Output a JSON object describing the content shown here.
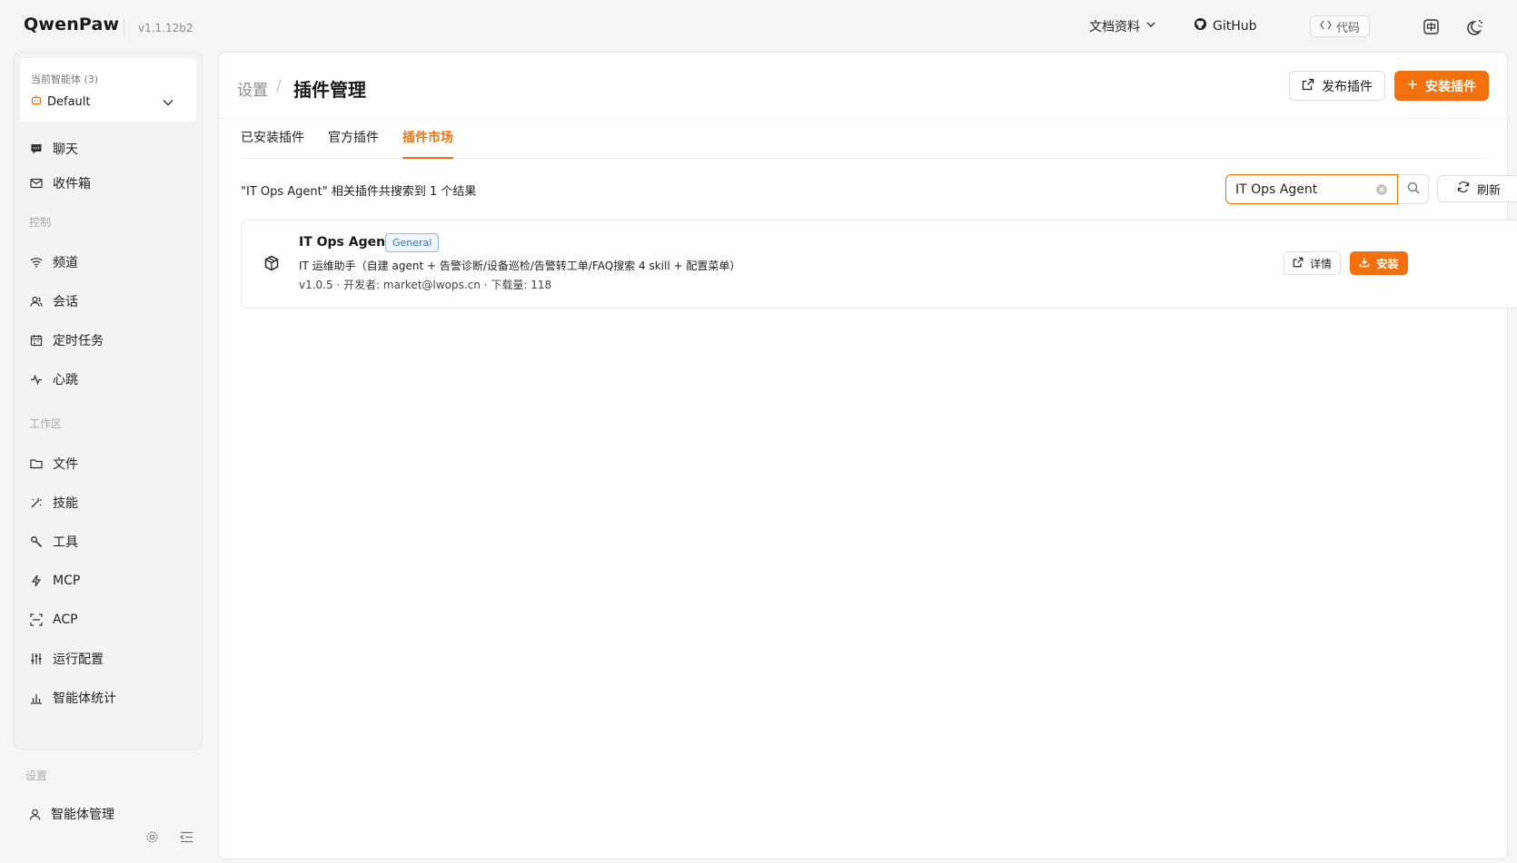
{
  "app": {
    "logo": "QwenPaw",
    "version": "v1.1.12b2"
  },
  "topnav": {
    "docs_label": "文档资料",
    "github_label": "GitHub",
    "code_label": "代码"
  },
  "sidebar": {
    "agent_label": "当前智能体 (3)",
    "agent_value": "Default",
    "items": [
      {
        "label": "聊天"
      },
      {
        "label": "收件箱"
      },
      {
        "label": "频道"
      },
      {
        "label": "会话"
      },
      {
        "label": "定时任务"
      },
      {
        "label": "心跳"
      },
      {
        "label": "文件"
      },
      {
        "label": "技能"
      },
      {
        "label": "工具"
      },
      {
        "label": "MCP"
      },
      {
        "label": "ACP"
      },
      {
        "label": "运行配置"
      },
      {
        "label": "智能体统计"
      }
    ],
    "sections": {
      "control": "控制",
      "workspace": "工作区",
      "settings": "设置"
    },
    "agent_manage": "智能体管理"
  },
  "page": {
    "breadcrumb_parent": "设置",
    "breadcrumb_separator": "/",
    "title": "插件管理",
    "publish_label": "发布插件",
    "install_plugin_label": "安装插件",
    "tabs": [
      {
        "label": "已安装插件"
      },
      {
        "label": "官方插件"
      },
      {
        "label": "插件市场"
      }
    ],
    "result_text": "\"IT Ops Agent\" 相关插件共搜索到 1 个结果",
    "search": {
      "value": "IT Ops Agent"
    },
    "refresh_label": "刷新"
  },
  "plugin": {
    "name": "IT Ops Agent",
    "tag": "General",
    "description": "IT 运维助手（自建 agent + 告警诊断/设备巡检/告警转工单/FAQ搜索 4 skill + 配置菜单）",
    "meta": "v1.0.5 · 开发者: market@lwops.cn · 下载量: 118",
    "detail_label": "详情",
    "install_label": "安装"
  },
  "colors": {
    "accent": "#f4700c",
    "tag_blue": "#2f75d6"
  }
}
